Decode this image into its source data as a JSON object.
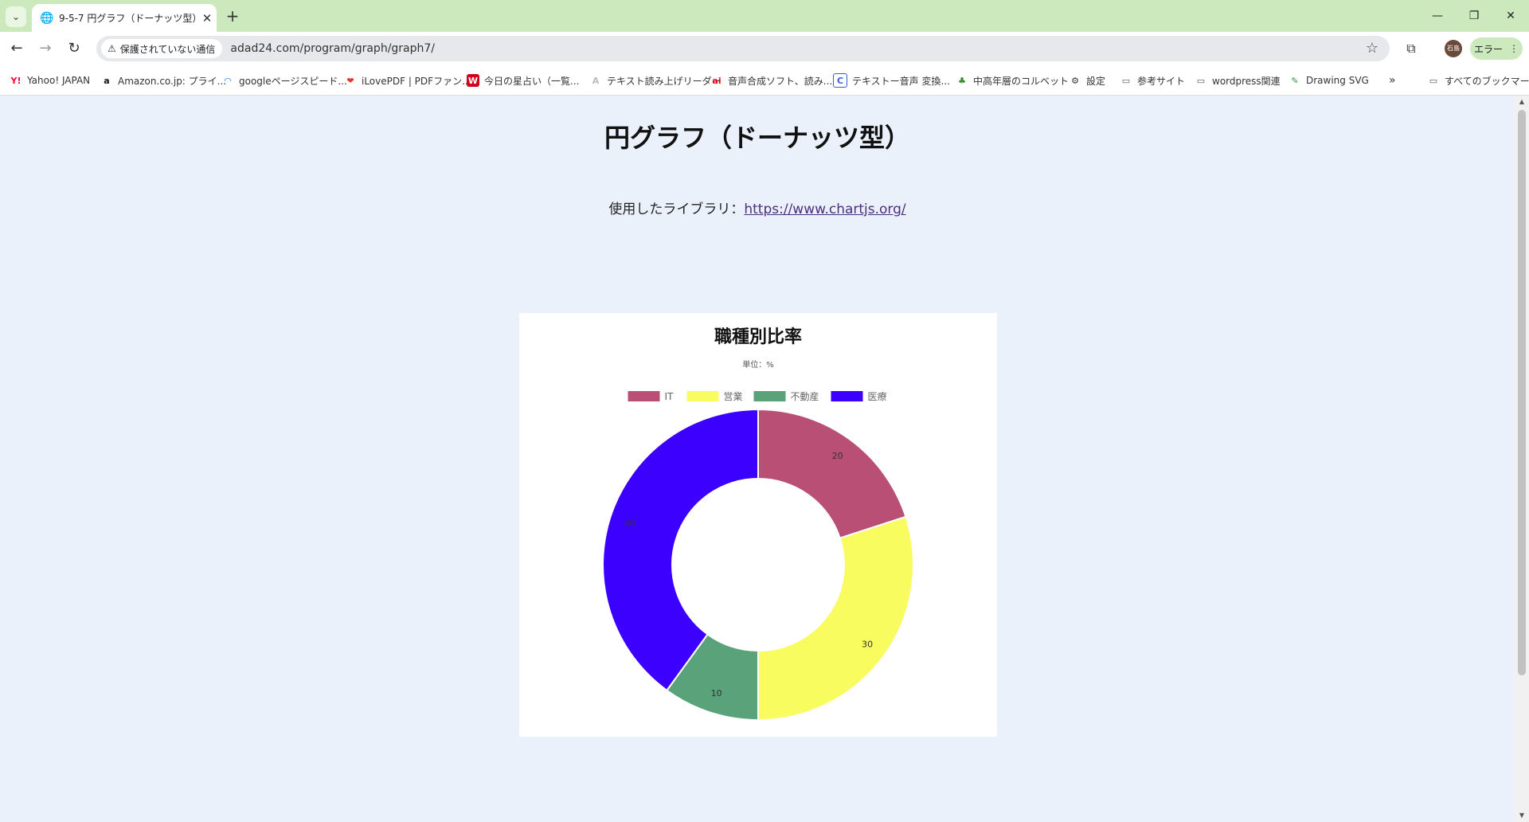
{
  "browser": {
    "tab_title": "9-5-7 円グラフ（ドーナッツ型）",
    "security_label": "保護されていない通信",
    "url": "adad24.com/program/graph/graph7/",
    "error_chip": "エラー",
    "avatar_text": "石島",
    "bookmarks": [
      {
        "label": "Yahoo! JAPAN",
        "icon": "yahoo-icon"
      },
      {
        "label": "Amazon.co.jp: プライ...",
        "icon": "amazon-icon"
      },
      {
        "label": "googleページスピード...",
        "icon": "pagespeed-icon"
      },
      {
        "label": "iLovePDF | PDFファン...",
        "icon": "heart-icon"
      },
      {
        "label": "今日の星占い（一覧...",
        "icon": "horoscope-icon"
      },
      {
        "label": "テキスト読み上げリーダー",
        "icon": "reader-icon"
      },
      {
        "label": "音声合成ソフト、読み...",
        "icon": "ai-icon"
      },
      {
        "label": "テキストー音声 変換...",
        "icon": "c-icon"
      },
      {
        "label": "中高年層のコルベット",
        "icon": "frog-icon"
      },
      {
        "label": "設定",
        "icon": "gear-icon"
      },
      {
        "label": "参考サイト",
        "icon": "folder-icon"
      },
      {
        "label": "wordpress関連",
        "icon": "folder-icon"
      },
      {
        "label": "Drawing SVG",
        "icon": "svg-icon"
      },
      {
        "label": "すべてのブックマーク",
        "icon": "folder-icon"
      }
    ]
  },
  "page": {
    "title": "円グラフ（ドーナッツ型）",
    "library_prefix": "使用したライブラリ：",
    "library_link": "https://www.chartjs.org/"
  },
  "chart_data": {
    "type": "pie",
    "title": "職種別比率",
    "subtitle": "単位：%",
    "legend_position": "top",
    "categories": [
      "IT",
      "営業",
      "不動産",
      "医療"
    ],
    "values": [
      20,
      30,
      10,
      40
    ],
    "colors": [
      "#b94f74",
      "#f9fc5f",
      "#5aa27a",
      "#3c00ff"
    ],
    "donut": true
  }
}
